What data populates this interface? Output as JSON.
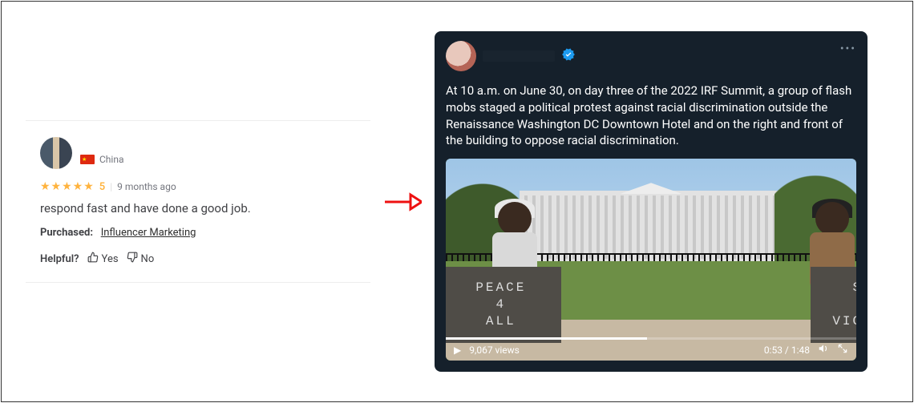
{
  "review": {
    "country": "China",
    "rating_value": "5",
    "time_ago": "9 months ago",
    "text": "respond fast and have done a good job.",
    "purchased_label": "Purchased:",
    "purchased_item": "Influencer Marketing",
    "helpful_label": "Helpful?",
    "yes_label": "Yes",
    "no_label": "No"
  },
  "tweet": {
    "text": "At 10 a.m. on June 30, on day three of the 2022 IRF Summit, a group of flash mobs staged a political protest against racial discrimination outside the Renaissance Washington DC Downtown Hotel and on the right and front of the building to oppose racial discrimination.",
    "views": "9,067 views",
    "time": "0:53 / 1:48",
    "sign_left": "PEACE\n4\nALL",
    "sign_right": "STOP\nTHE\nVIOLENCE"
  }
}
